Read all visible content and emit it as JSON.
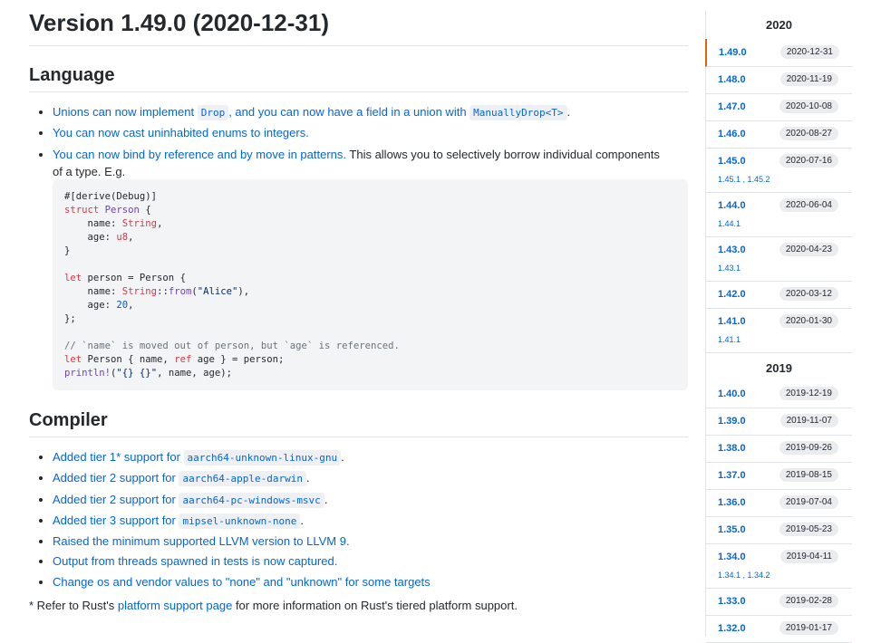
{
  "page": {
    "title": "Version 1.49.0 (2020-12-31)",
    "language_heading": "Language",
    "compiler_heading": "Compiler",
    "language_items": [
      {
        "pre": "Unions can now implement ",
        "code": "Drop",
        "post": ", and you can now have a field in a union with ",
        "code2": "ManuallyDrop<T>",
        "post2": "."
      },
      {
        "text": "You can now cast uninhabited enums to integers."
      },
      {
        "link": "You can now bind by reference and by move in patterns.",
        "rest": " This allows you to selectively borrow individual components",
        "rest2": "of a type. E.g."
      }
    ],
    "code": "#[derive(Debug)]\nstruct Person {\n    name: String,\n    age: u8,\n}\n\nlet person = Person {\n    name: String::from(\"Alice\"),\n    age: 20,\n};\n\n// `name` is moved out of person, but `age` is referenced.\nlet Person { name, ref age } = person;\nprintln!(\"{} {}\", name, age);",
    "compiler_items": [
      {
        "text": "Added tier 1* support for ",
        "code": "aarch64-unknown-linux-gnu",
        "post": "."
      },
      {
        "text": "Added tier 2 support for ",
        "code": "aarch64-apple-darwin",
        "post": "."
      },
      {
        "text": "Added tier 2 support for ",
        "code": "aarch64-pc-windows-msvc",
        "post": "."
      },
      {
        "text": "Added tier 3 support for ",
        "code": "mipsel-unknown-none",
        "post": "."
      },
      {
        "text": "Raised the minimum supported LLVM version to LLVM 9."
      },
      {
        "text": "Output from threads spawned in tests is now captured."
      },
      {
        "text": "Change os and vendor values to \"none\" and \"unknown\" for some targets"
      }
    ],
    "footnote_pre": "* Refer to Rust's ",
    "footnote_link": "platform support page",
    "footnote_post": " for more information on Rust's tiered platform support."
  },
  "sidebar": {
    "year_2020": "2020",
    "year_2019": "2019",
    "releases_2020": [
      {
        "version": "1.49.0",
        "date": "2020-12-31"
      },
      {
        "version": "1.48.0",
        "date": "2020-11-19"
      },
      {
        "version": "1.47.0",
        "date": "2020-10-08"
      },
      {
        "version": "1.46.0",
        "date": "2020-08-27"
      },
      {
        "version": "1.45.0",
        "date": "2020-07-16",
        "subs": "1.45.1 , 1.45.2"
      },
      {
        "version": "1.44.0",
        "date": "2020-06-04",
        "subs": "1.44.1"
      },
      {
        "version": "1.43.0",
        "date": "2020-04-23",
        "subs": "1.43.1"
      },
      {
        "version": "1.42.0",
        "date": "2020-03-12"
      },
      {
        "version": "1.41.0",
        "date": "2020-01-30",
        "subs": "1.41.1"
      }
    ],
    "releases_2019": [
      {
        "version": "1.40.0",
        "date": "2019-12-19"
      },
      {
        "version": "1.39.0",
        "date": "2019-11-07"
      },
      {
        "version": "1.38.0",
        "date": "2019-09-26"
      },
      {
        "version": "1.37.0",
        "date": "2019-08-15"
      },
      {
        "version": "1.36.0",
        "date": "2019-07-04"
      },
      {
        "version": "1.35.0",
        "date": "2019-05-23"
      },
      {
        "version": "1.34.0",
        "date": "2019-04-11",
        "subs": "1.34.1 , 1.34.2"
      },
      {
        "version": "1.33.0",
        "date": "2019-02-28"
      },
      {
        "version": "1.32.0",
        "date": "2019-01-17"
      }
    ]
  }
}
